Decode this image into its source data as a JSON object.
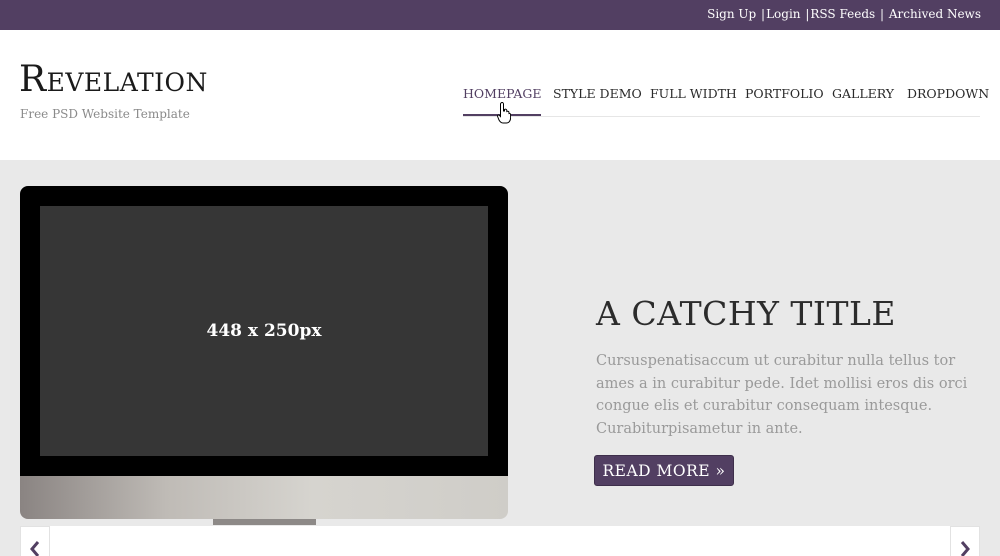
{
  "toplinks": {
    "signup": "Sign Up",
    "login": "Login",
    "rss": "RSS Feeds",
    "archived": "Archived News",
    "separator": "|"
  },
  "header": {
    "logo": "Revelation",
    "tagline": "Free PSD Website Template"
  },
  "nav": {
    "items": [
      "HOMEPAGE",
      "STYLE DEMO",
      "FULL WIDTH",
      "PORTFOLIO",
      "GALLERY",
      "DROPDOWN"
    ],
    "active_index": 0
  },
  "hero": {
    "screen_label": "448 x 250px",
    "title": "A CATCHY TITLE",
    "text": "Cursuspenatisaccum ut curabitur nulla tellus tor ames a in curabitur pede. Idet mollisi eros dis orci congue elis et curabitur consequam intesque. Curabiturpisametur in ante.",
    "button": "READ MORE »"
  },
  "colors": {
    "brand": "#523f62",
    "background": "#e9e9e9"
  },
  "icons": {
    "cursor": "hand-pointer-icon",
    "prev": "chevron-left-icon",
    "next": "chevron-right-icon"
  }
}
